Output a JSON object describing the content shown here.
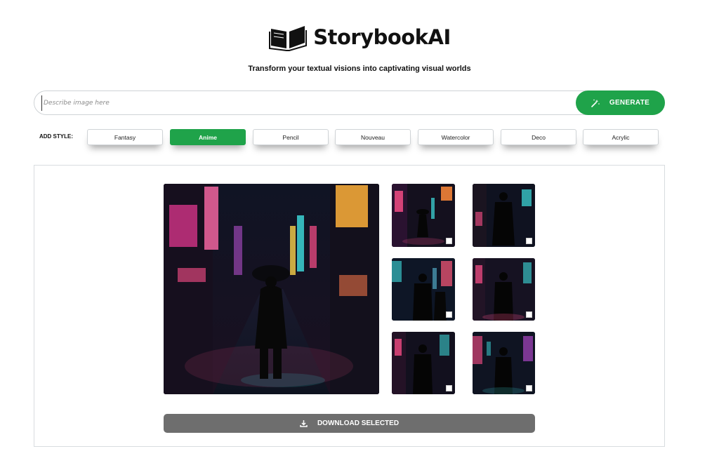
{
  "brand": {
    "name": "StorybookAI",
    "icon": "open-book-icon"
  },
  "tagline": "Transform your textual visions into captivating visual worlds",
  "search": {
    "placeholder": "Describe image here",
    "value": ""
  },
  "generate": {
    "label": "GENERATE",
    "icon": "magic-wand-icon"
  },
  "styles": {
    "label": "ADD STYLE:",
    "options": [
      "Fantasy",
      "Anime",
      "Pencil",
      "Nouveau",
      "Watercolor",
      "Deco",
      "Acrylic"
    ],
    "selected": "Anime"
  },
  "gallery": {
    "main_image": "neon-city-rain-umbrella",
    "thumbnails": [
      {
        "name": "thumb-1",
        "checked": false
      },
      {
        "name": "thumb-2",
        "checked": false
      },
      {
        "name": "thumb-3",
        "checked": false
      },
      {
        "name": "thumb-4",
        "checked": false
      },
      {
        "name": "thumb-5",
        "checked": false
      },
      {
        "name": "thumb-6",
        "checked": false
      }
    ]
  },
  "download": {
    "label": "DOWNLOAD SELECTED",
    "icon": "download-icon"
  },
  "colors": {
    "accent": "#1fa34a",
    "download_bg": "#6e6e6e"
  }
}
